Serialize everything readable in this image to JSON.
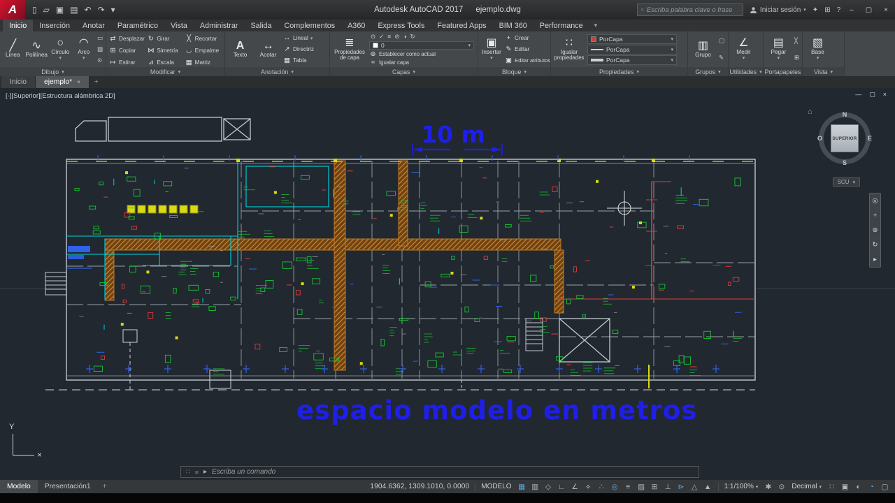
{
  "titlebar": {
    "app_title": "Autodesk AutoCAD 2017",
    "doc_title": "ejemplo.dwg",
    "search_placeholder": "Escriba palabra clave o frase",
    "signin_label": "Iniciar sesión",
    "help_label": "?"
  },
  "quick_access_icons": [
    "new-file",
    "open-file",
    "save",
    "plot",
    "undo",
    "redo",
    "qat-customize"
  ],
  "ribbon": {
    "tabs": [
      {
        "label": "Inicio",
        "active": true
      },
      {
        "label": "Inserción"
      },
      {
        "label": "Anotar"
      },
      {
        "label": "Paramétrico"
      },
      {
        "label": "Vista"
      },
      {
        "label": "Administrar"
      },
      {
        "label": "Salida"
      },
      {
        "label": "Complementos"
      },
      {
        "label": "A360"
      },
      {
        "label": "Express Tools"
      },
      {
        "label": "Featured Apps"
      },
      {
        "label": "BIM 360"
      },
      {
        "label": "Performance"
      }
    ],
    "panels": {
      "dibujo": {
        "label": "Dibujo",
        "buttons": [
          "Línea",
          "Polilínea",
          "Círculo",
          "Arco"
        ]
      },
      "modificar": {
        "label": "Modificar",
        "buttons": [
          "Desplazar",
          "Girar",
          "Recortar",
          "Copiar",
          "Simetría",
          "Empalme",
          "Estirar",
          "Escala",
          "Matriz"
        ]
      },
      "anotacion": {
        "label": "Anotación",
        "big": [
          "Texto",
          "Acotar"
        ],
        "small": [
          "Lineal",
          "Directriz",
          "Tabla"
        ]
      },
      "capas": {
        "label": "Capas",
        "big_label": "Propiedades de capa",
        "current_layer": "0",
        "buttons": [
          "Establecer como actual",
          "Igualar capa"
        ]
      },
      "bloque": {
        "label": "Bloque",
        "big_label": "Insertar",
        "buttons": [
          "Crear",
          "Editar",
          "Editar atributos"
        ]
      },
      "propiedades": {
        "label": "Propiedades",
        "big_label": "Igualar propiedades",
        "combos": [
          "PorCapa",
          "PorCapa",
          "PorCapa"
        ]
      },
      "grupos": {
        "label": "Grupos",
        "big_label": "Grupo"
      },
      "utilidades": {
        "label": "Utilidades",
        "big_label": "Medir"
      },
      "portapapeles": {
        "label": "Portapapeles",
        "big_label": "Pegar"
      },
      "vista": {
        "label": "Vista",
        "big_label": "Base"
      }
    }
  },
  "file_tabs": [
    {
      "label": "Inicio",
      "active": false
    },
    {
      "label": "ejemplo*",
      "active": true
    }
  ],
  "viewport": {
    "label": "[-][Superior][Estructura alámbrica 2D]",
    "dim_text": "10 m",
    "annotation": "espacio modelo en metros",
    "viewcube": {
      "north": "N",
      "south": "S",
      "east": "E",
      "west": "O",
      "face": "SUPERIOR",
      "scu": "SCU"
    }
  },
  "command_line": {
    "placeholder": "Escriba un comando"
  },
  "status_bar": {
    "model_tab": "Modelo",
    "layout_tab": "Presentación1",
    "new_layout": "+",
    "coordinates": "1904.6362, 1309.1010, 0.0000",
    "space_label": "MODELO",
    "scale_label": "1:1/100%",
    "units_label": "Decimal",
    "icons": [
      {
        "name": "grid",
        "active": true
      },
      {
        "name": "snap-mode",
        "active": false
      },
      {
        "name": "infer-constraints",
        "active": false
      },
      {
        "name": "ortho-mode",
        "active": false
      },
      {
        "name": "polar-tracking",
        "active": false
      },
      {
        "name": "isometric-drafting",
        "active": false
      },
      {
        "name": "object-snap-tracking",
        "active": false
      },
      {
        "name": "object-snap",
        "active": true
      },
      {
        "name": "lineweight",
        "active": false
      },
      {
        "name": "transparency",
        "active": false
      },
      {
        "name": "selection-cycling",
        "active": false
      },
      {
        "name": "dynamic-ucs",
        "active": false
      },
      {
        "name": "dynamic-input",
        "active": true
      },
      {
        "name": "annotation-visibility",
        "active": false
      },
      {
        "name": "autoscale",
        "active": false
      }
    ],
    "right_icons": [
      {
        "name": "workspace-switching",
        "active": false
      },
      {
        "name": "annotation-monitor",
        "active": false
      },
      {
        "name": "quick-properties",
        "active": false
      },
      {
        "name": "lock-ui",
        "active": false
      },
      {
        "name": "isolate-objects",
        "active": false
      },
      {
        "name": "graphics-performance",
        "active": true
      },
      {
        "name": "clean-screen",
        "active": false
      }
    ]
  },
  "colors": {
    "canvas_bg": "#212830",
    "cad_blue": "#1f1fe8",
    "cad_green": "#17c631",
    "cad_red": "#e23b3b",
    "cad_cyan": "#00d4de",
    "cad_yellow": "#d9d916"
  }
}
